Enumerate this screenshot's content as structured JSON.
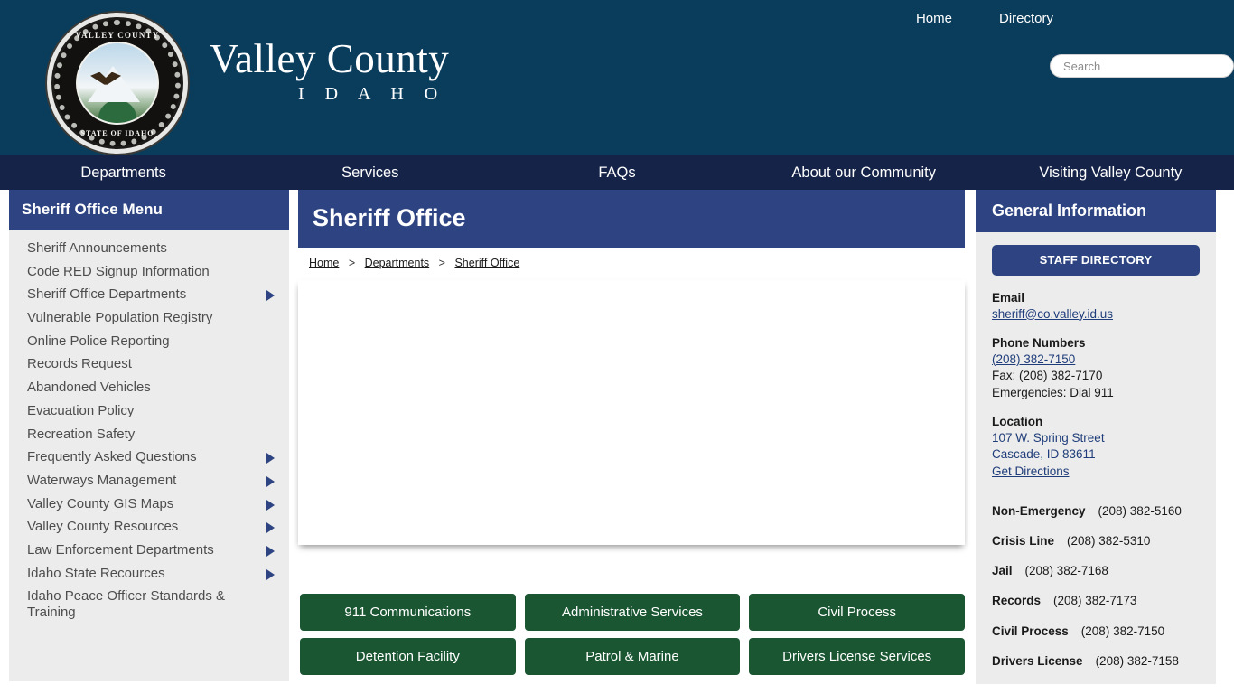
{
  "brand": {
    "title": "Valley County",
    "subtitle": "I D A H O",
    "seal_top": "VALLEY COUNTY",
    "seal_bottom": "STATE OF IDAHO"
  },
  "header": {
    "links": [
      {
        "label": "Home"
      },
      {
        "label": "Directory"
      }
    ],
    "search": {
      "placeholder": "Search",
      "value": ""
    }
  },
  "main_nav": [
    {
      "label": "Departments"
    },
    {
      "label": "Services"
    },
    {
      "label": "FAQs"
    },
    {
      "label": "About our Community"
    },
    {
      "label": "Visiting Valley County"
    }
  ],
  "sidebar": {
    "title": "Sheriff Office Menu",
    "items": [
      {
        "label": "Sheriff Announcements",
        "has_submenu": false
      },
      {
        "label": "Code RED Signup Information",
        "has_submenu": false
      },
      {
        "label": "Sheriff Office Departments",
        "has_submenu": true
      },
      {
        "label": "Vulnerable Population Registry",
        "has_submenu": false
      },
      {
        "label": "Online Police Reporting",
        "has_submenu": false
      },
      {
        "label": "Records Request",
        "has_submenu": false
      },
      {
        "label": "Abandoned Vehicles",
        "has_submenu": false
      },
      {
        "label": "Evacuation Policy",
        "has_submenu": false
      },
      {
        "label": "Recreation Safety",
        "has_submenu": false
      },
      {
        "label": "Frequently Asked Questions",
        "has_submenu": true
      },
      {
        "label": "Waterways Management",
        "has_submenu": true
      },
      {
        "label": "Valley County GIS Maps",
        "has_submenu": true
      },
      {
        "label": "Valley County Resources",
        "has_submenu": true
      },
      {
        "label": "Law Enforcement Departments",
        "has_submenu": true
      },
      {
        "label": "Idaho State Recources",
        "has_submenu": true
      },
      {
        "label": "Idaho Peace Officer Standards & Training",
        "has_submenu": false
      }
    ]
  },
  "content": {
    "title": "Sheriff Office",
    "breadcrumb": [
      {
        "label": "Home"
      },
      {
        "label": "Departments"
      },
      {
        "label": "Sheriff Office"
      }
    ],
    "breadcrumb_separator": ">",
    "buttons": [
      {
        "label": "911 Communications"
      },
      {
        "label": "Administrative Services"
      },
      {
        "label": "Civil Process"
      },
      {
        "label": "Detention Facility"
      },
      {
        "label": "Patrol & Marine"
      },
      {
        "label": "Drivers License Services"
      }
    ]
  },
  "general_info": {
    "title": "General Information",
    "staff_directory_label": "STAFF DIRECTORY",
    "email_label": "Email",
    "email": "sheriff@co.valley.id.us",
    "phone_label": "Phone Numbers",
    "phone_main": "(208) 382-7150",
    "fax": "Fax: (208) 382-7170",
    "emergencies": "Emergencies: Dial 911",
    "location_label": "Location",
    "address_line1": "107 W. Spring Street",
    "address_line2": "Cascade, ID 83611",
    "directions_label": "Get Directions",
    "phone_list": [
      {
        "name": "Non-Emergency",
        "number": "(208) 382-5160"
      },
      {
        "name": "Crisis Line",
        "number": "(208) 382-5310"
      },
      {
        "name": "Jail",
        "number": "(208) 382-7168"
      },
      {
        "name": "Records",
        "number": "(208) 382-7173"
      },
      {
        "name": "Civil Process",
        "number": "(208) 382-7150"
      },
      {
        "name": "Drivers License",
        "number": "(208) 382-7158"
      }
    ]
  },
  "colors": {
    "header_bg": "#0a3c5c",
    "nav_bg": "#152348",
    "panel_blue": "#2e4482",
    "button_green": "#1a5632",
    "sidebar_bg": "#ececec",
    "link_blue": "#1f3d7a"
  }
}
